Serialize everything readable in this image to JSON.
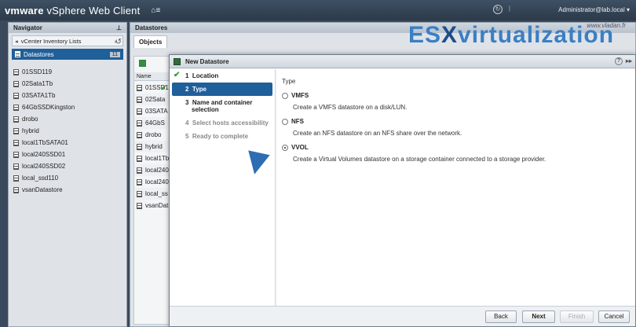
{
  "header": {
    "brand": "vmware",
    "product": "vSphere Web Client",
    "home_glyph": "⌂≡",
    "user": "Administrator@lab.local ▾"
  },
  "watermark": {
    "url": "www.vladan.fr",
    "es": "ES",
    "x": "X",
    "rest": "virtualization"
  },
  "navigator": {
    "title": "Navigator",
    "path": "vCenter Inventory Lists",
    "selected": "Datastores",
    "count": "11",
    "items": [
      "01SSD119",
      "02Sata1Tb",
      "03SATA1Tb",
      "64GbSSDKingston",
      "drobo",
      "hybrid",
      "local1TbSATA01",
      "local240SSD01",
      "local240SSD02",
      "local_ssd110",
      "vsanDatastore"
    ]
  },
  "main": {
    "title": "Datastores",
    "tab": "Objects",
    "col_name": "Name",
    "rows": [
      "01SSD1",
      "02Sata",
      "03SATA",
      "64GbS",
      "drobo",
      "hybrid",
      "local1Tb",
      "local240",
      "local240",
      "local_ss",
      "vsanDat"
    ]
  },
  "dialog": {
    "title": "New Datastore",
    "help": "?",
    "expand": "▸▸",
    "steps": [
      {
        "num": "1",
        "label": "Location"
      },
      {
        "num": "2",
        "label": "Type"
      },
      {
        "num": "3",
        "label": "Name and container selection"
      },
      {
        "num": "4",
        "label": "Select hosts accessibility"
      },
      {
        "num": "5",
        "label": "Ready to complete"
      }
    ],
    "section_title": "Type",
    "options": [
      {
        "label": "VMFS",
        "desc": "Create a VMFS datastore on a disk/LUN."
      },
      {
        "label": "NFS",
        "desc": "Create an NFS datastore on an NFS share over the network."
      },
      {
        "label": "VVOL",
        "desc": "Create a Virtual Volumes datastore on a storage container connected to a storage provider."
      }
    ],
    "selected_option": "VVOL",
    "buttons": {
      "back": "Back",
      "next": "Next",
      "finish": "Finish",
      "cancel": "Cancel"
    }
  }
}
